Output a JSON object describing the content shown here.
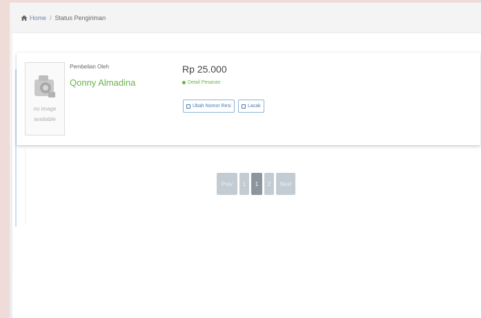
{
  "breadcrumb": {
    "home_label": "Home",
    "separator": "/",
    "current_label": "Status Pengiriman"
  },
  "order": {
    "thumbnail_text_line1": "no image",
    "thumbnail_text_line2": "available",
    "buyer_label": "Pembelian Oleh",
    "buyer_name": "Qonny Almadina",
    "price": "Rp 25.000",
    "status_text": "Detail Pesanan",
    "resi_button_label": "Ubah Nomor Resi",
    "track_button_label": "Lacak"
  },
  "pagination": {
    "prev_label": "Prev",
    "page_before": "1",
    "page_current": "1",
    "page_after": "2",
    "next_label": "Next"
  },
  "colors": {
    "accent_green": "#6bb24a",
    "link_blue": "#4b7cb0",
    "pager_grey": "#c4ccd3"
  }
}
